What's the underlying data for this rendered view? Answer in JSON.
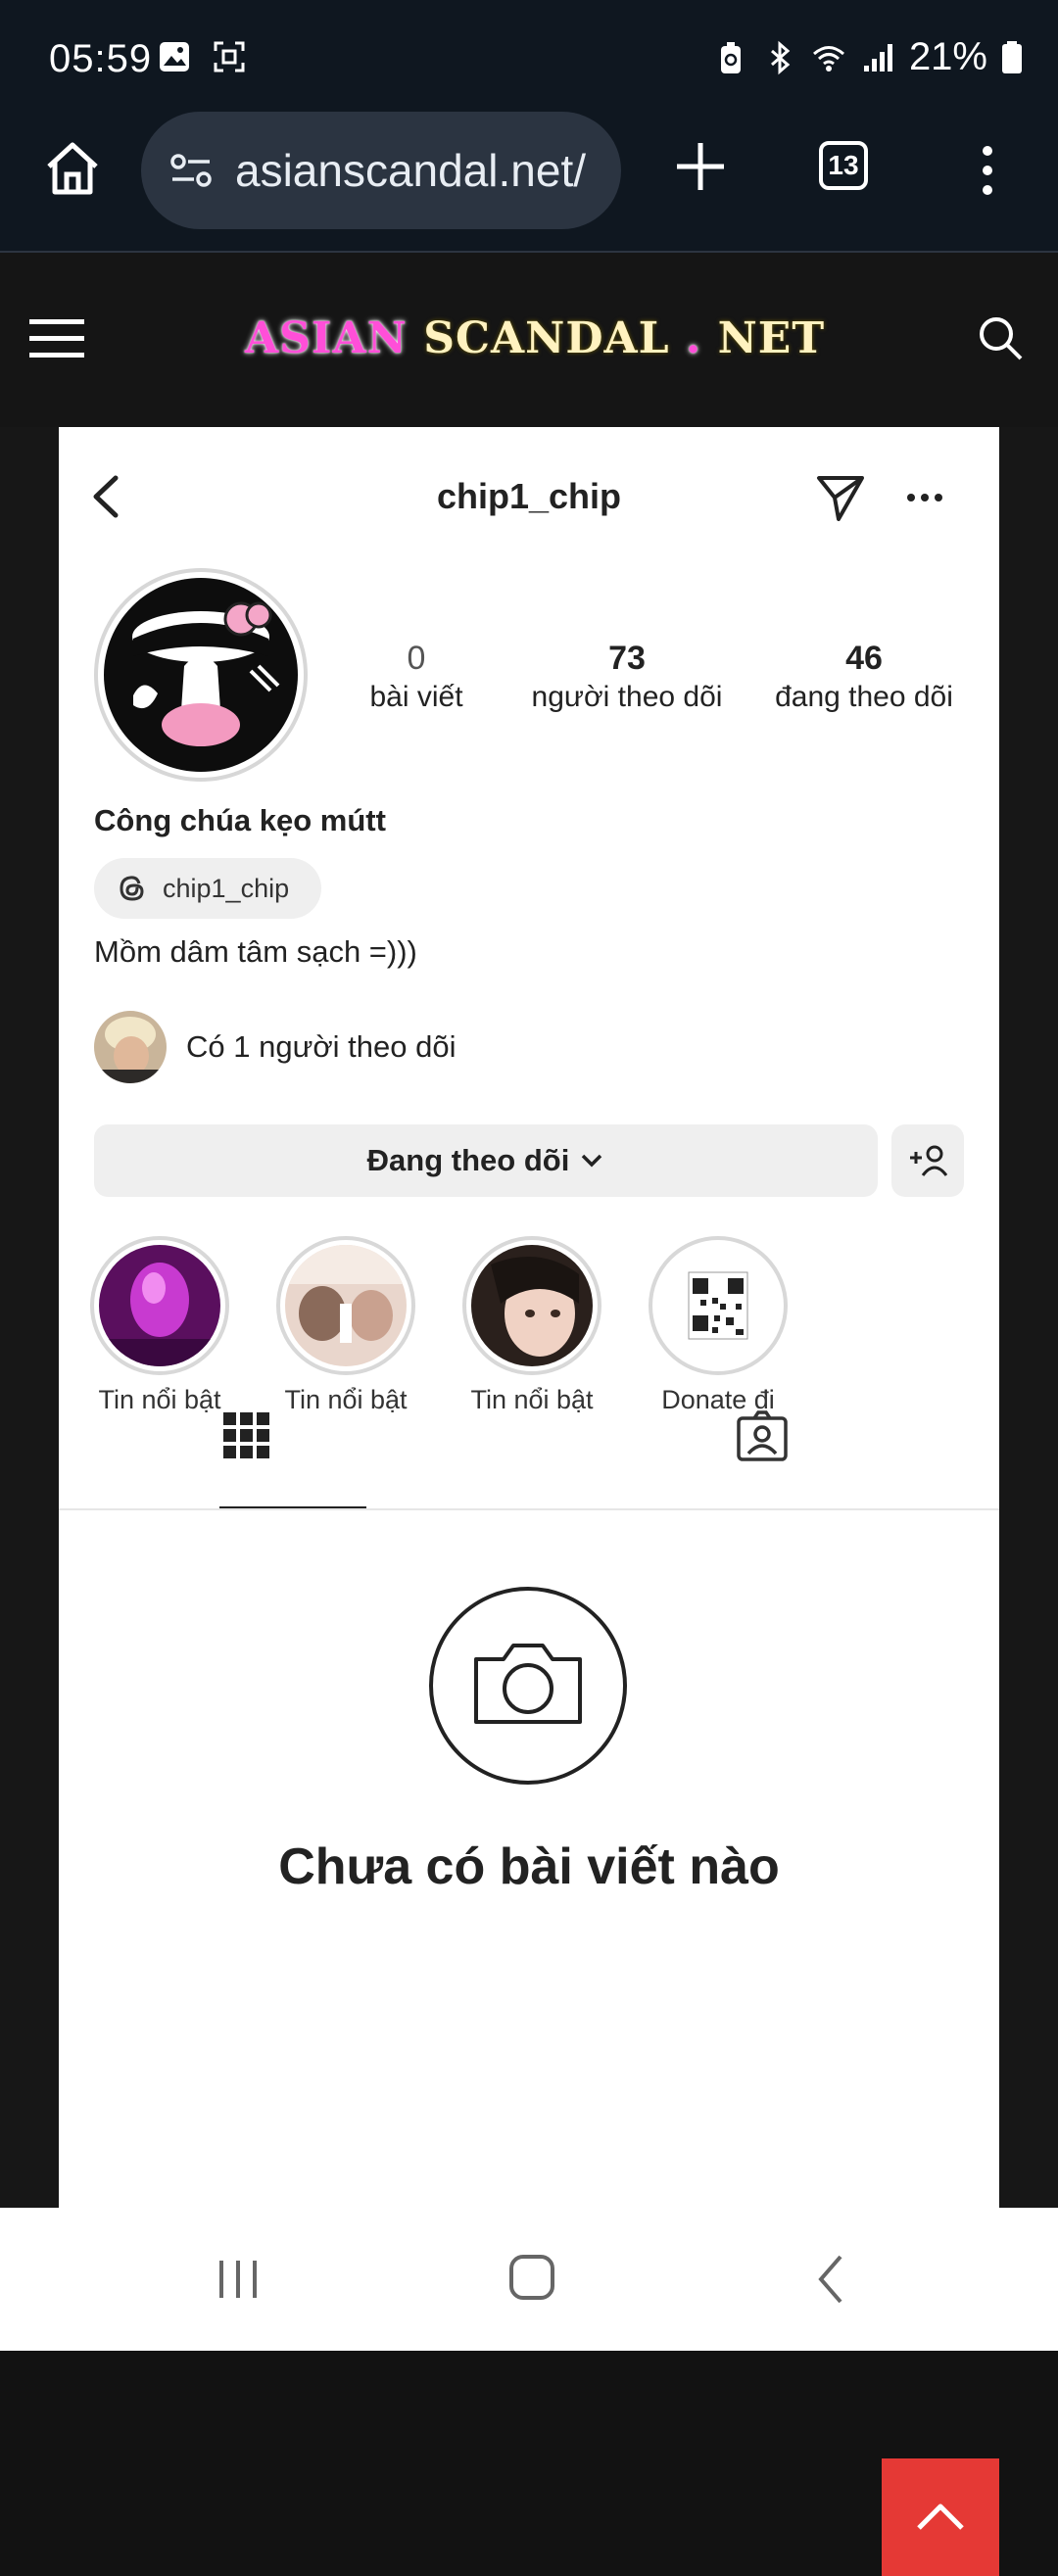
{
  "status_bar": {
    "time": "05:59",
    "battery": "21%",
    "left_icons": [
      "gallery-icon",
      "screenshot-icon"
    ],
    "right_icons": [
      "battery-saver-icon",
      "bluetooth-icon",
      "wifi-icon",
      "signal-icon",
      "battery-icon"
    ]
  },
  "browser": {
    "url": "asianscandal.net/",
    "tab_count": "13"
  },
  "site": {
    "logo_part1": "ASIAN",
    "logo_part2": "SCANDAL",
    "logo_dot": ".",
    "logo_part3": "NET"
  },
  "profile": {
    "username": "chip1_chip",
    "stats": {
      "posts_count": "0",
      "posts_label": "bài viết",
      "followers_count": "73",
      "followers_label": "người theo dõi",
      "following_count": "46",
      "following_label": "đang theo dõi"
    },
    "display_name": "Công chúa kẹo mútt",
    "threads_handle": "chip1_chip",
    "bio": "Mồm dâm tâm sạch =)))",
    "mutual_followers": "Có 1 người theo dõi",
    "following_button": "Đang theo dõi",
    "highlights": [
      {
        "label": "Tin nổi bật"
      },
      {
        "label": "Tin nổi bật"
      },
      {
        "label": "Tin nổi bật"
      },
      {
        "label": "Donate đi"
      }
    ],
    "empty_state": "Chưa có bài viết nào"
  },
  "colors": {
    "status_bg": "#0f1720",
    "url_pill": "#2b3441",
    "logo_pink": "#ff4fd8",
    "scroll_top_red": "#e53935"
  }
}
